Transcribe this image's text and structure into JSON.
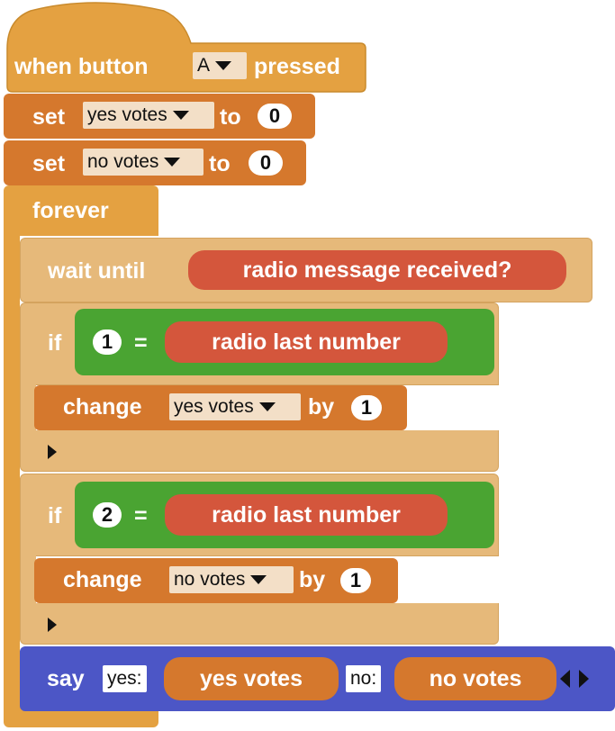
{
  "colors": {
    "events": "#e4a141",
    "control_outline": "#e4a141",
    "control_fill": "#e6b97a",
    "variables": "#d5782d",
    "logic_compare": "#4aa432",
    "radio_reporter": "#d4563c",
    "say_block": "#4c56c6"
  },
  "hat": {
    "prefix": "when button",
    "button": "A",
    "suffix": "pressed"
  },
  "set1": {
    "label": "set",
    "var": "yes votes",
    "to": "to",
    "value": "0"
  },
  "set2": {
    "label": "set",
    "var": "no votes",
    "to": "to",
    "value": "0"
  },
  "forever": {
    "label": "forever"
  },
  "wait": {
    "label": "wait until",
    "condition": "radio message received?"
  },
  "if1": {
    "label": "if",
    "left": "1",
    "op": "=",
    "right": "radio last number"
  },
  "change1": {
    "label": "change",
    "var": "yes votes",
    "by": "by",
    "value": "1"
  },
  "if2": {
    "label": "if",
    "left": "2",
    "op": "=",
    "right": "radio last number"
  },
  "change2": {
    "label": "change",
    "var": "no votes",
    "by": "by",
    "value": "1"
  },
  "say": {
    "label": "say",
    "str1": "yes:",
    "var1": "yes votes",
    "str2": "no:",
    "var2": "no votes",
    "arrows_icon": "left-right-arrows-icon"
  }
}
